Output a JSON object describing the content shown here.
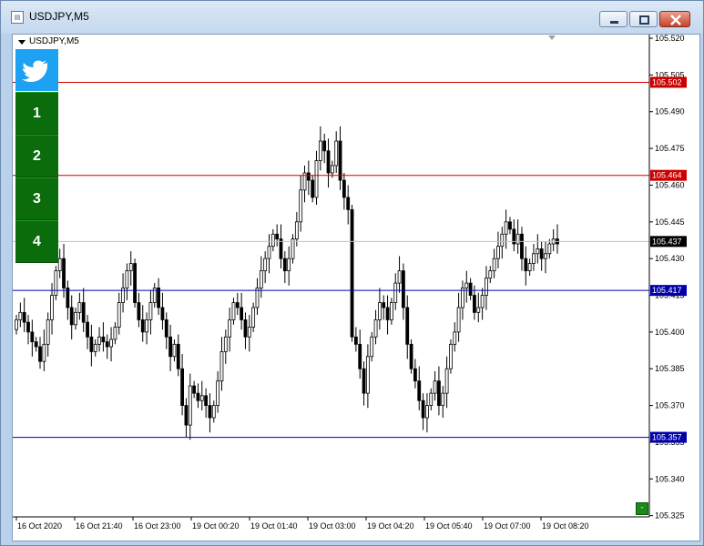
{
  "window": {
    "title": "USDJPY,M5",
    "app_icon": "metatrader-chart-icon"
  },
  "chart_header": {
    "symbol_label": "USDJPY,M5"
  },
  "panel": {
    "twitter_icon": "twitter-bird-icon",
    "buttons": [
      "1",
      "2",
      "3",
      "4"
    ],
    "minus_label": "-"
  },
  "colors": {
    "resistance_line": "#cc0000",
    "support_line": "#0000aa",
    "current_line": "#c0c0c0",
    "panel_green": "#0b6c0b",
    "twitter_blue": "#1da1f2"
  },
  "chart_data": {
    "type": "candlestick",
    "symbol": "USDJPY",
    "timeframe": "M5",
    "y_ticks": [
      "105.520",
      "105.505",
      "105.490",
      "105.475",
      "105.460",
      "105.445",
      "105.430",
      "105.415",
      "105.400",
      "105.385",
      "105.370",
      "105.355",
      "105.340",
      "105.325"
    ],
    "ylim": [
      105.3245,
      105.5215
    ],
    "x_ticks": [
      "16 Oct 2020",
      "16 Oct 21:40",
      "16 Oct 23:00",
      "19 Oct 00:20",
      "19 Oct 01:40",
      "19 Oct 03:00",
      "19 Oct 04:20",
      "19 Oct 05:40",
      "19 Oct 07:00",
      "19 Oct 08:20"
    ],
    "price_lines": [
      {
        "value": 105.502,
        "label": "105.502",
        "kind": "resistance"
      },
      {
        "value": 105.464,
        "label": "105.464",
        "kind": "resistance"
      },
      {
        "value": 105.437,
        "label": "105.437",
        "kind": "current"
      },
      {
        "value": 105.417,
        "label": "105.417",
        "kind": "support"
      },
      {
        "value": 105.357,
        "label": "105.357",
        "kind": "support"
      }
    ],
    "series": [
      {
        "key": "close",
        "values": [
          105.405,
          105.408,
          105.404,
          105.4,
          105.396,
          105.394,
          105.388,
          105.395,
          105.405,
          105.415,
          105.425,
          105.43,
          105.418,
          105.41,
          105.403,
          105.408,
          105.412,
          105.404,
          105.398,
          105.392,
          105.395,
          105.398,
          105.396,
          105.394,
          105.397,
          105.402,
          105.412,
          105.418,
          105.425,
          105.428,
          105.412,
          105.405,
          105.4,
          105.405,
          105.412,
          105.418,
          105.41,
          105.405,
          105.398,
          105.39,
          105.395,
          105.385,
          105.37,
          105.362,
          105.378,
          105.375,
          105.372,
          105.374,
          105.37,
          105.365,
          105.37,
          105.38,
          105.392,
          105.398,
          105.405,
          105.412,
          105.41,
          105.405,
          105.398,
          105.402,
          105.41,
          105.418,
          105.425,
          105.43,
          105.435,
          105.44,
          105.438,
          105.43,
          105.425,
          105.43,
          105.438,
          105.445,
          105.458,
          105.465,
          105.462,
          105.455,
          105.47,
          105.478,
          105.474,
          105.465,
          105.468,
          105.478,
          105.462,
          105.455,
          105.45,
          105.398,
          105.395,
          105.385,
          105.375,
          105.39,
          105.398,
          105.405,
          105.412,
          105.41,
          105.405,
          105.412,
          105.42,
          105.425,
          105.41,
          105.395,
          105.385,
          105.38,
          105.372,
          105.365,
          105.37,
          105.375,
          105.38,
          105.37,
          105.375,
          105.385,
          105.395,
          105.4,
          105.41,
          105.418,
          105.42,
          105.415,
          105.408,
          105.41,
          105.415,
          105.422,
          105.425,
          105.43,
          105.435,
          105.44,
          105.445,
          105.442,
          105.436,
          105.44,
          105.43,
          105.425,
          105.428,
          105.432,
          105.434,
          105.43,
          105.432,
          105.436,
          105.438,
          105.436
        ]
      }
    ]
  }
}
